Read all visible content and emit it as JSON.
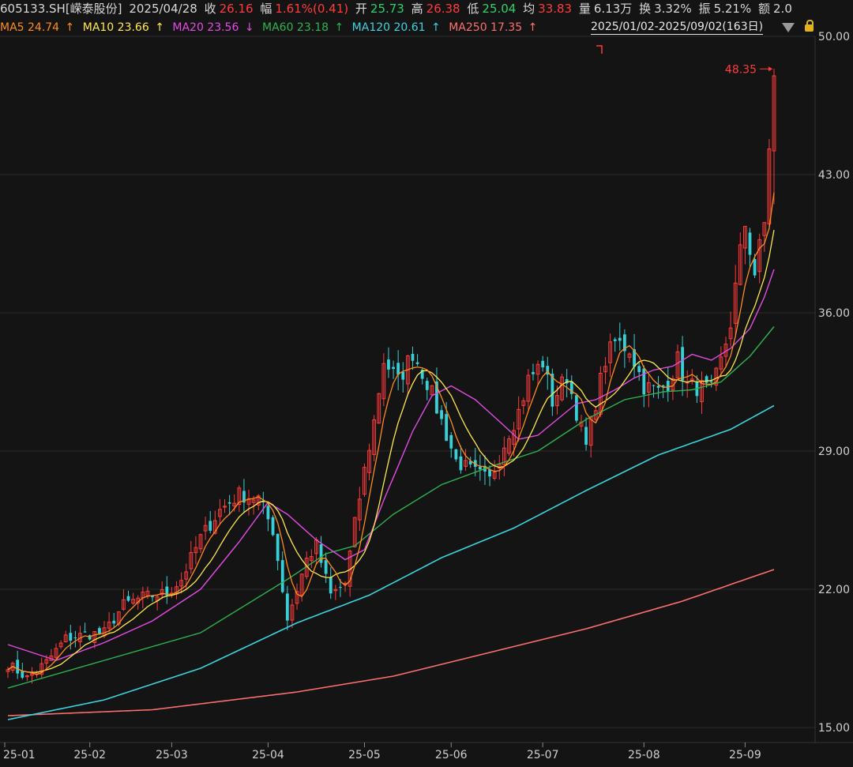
{
  "header": {
    "code": "605133.SH[嵘泰股份]",
    "date": "2025/04/28",
    "close_label": "收",
    "close": "26.16",
    "chg_label": "幅",
    "chg": "1.61%(0.41)",
    "open_label": "开",
    "open": "25.73",
    "high_label": "高",
    "high": "26.38",
    "low_label": "低",
    "low": "25.04",
    "avg_label": "均",
    "avg": "33.83",
    "vol_label": "量",
    "vol": "6.13万",
    "turn_label": "换",
    "turn": "3.32%",
    "amp_label": "振",
    "amp": "5.21%",
    "amt_label": "额",
    "amt": "2.0"
  },
  "ma_legend": [
    {
      "text": "MA5 24.74",
      "arrow": "↑",
      "color": "#ff8c1a"
    },
    {
      "text": "MA10 23.66",
      "arrow": "↑",
      "color": "#ffe84a"
    },
    {
      "text": "MA20 23.56",
      "arrow": "↓",
      "color": "#e34be3"
    },
    {
      "text": "MA60 23.18",
      "arrow": "↑",
      "color": "#2fb24f"
    },
    {
      "text": "MA120 20.61",
      "arrow": "↑",
      "color": "#39d4e0"
    },
    {
      "text": "MA250 17.35",
      "arrow": "↑",
      "color": "#ff6f6f"
    }
  ],
  "range_label": "2025/01/02-2025/09/02(163日)",
  "colors": {
    "up": "#ff3b3b",
    "down": "#37d0d8",
    "grid": "#2a2a2a",
    "background": "#141414"
  },
  "chart_data": {
    "type": "candlestick",
    "ylim": [
      15,
      50
    ],
    "yticks": [
      "50.00",
      "43.00",
      "36.00",
      "29.00",
      "22.00",
      "15.00"
    ],
    "ytick_values": [
      50,
      43,
      36,
      29,
      22,
      15
    ],
    "xticks": [
      "25-01",
      "25-02",
      "25-03",
      "25-04",
      "25-05",
      "25-06",
      "25-07",
      "25-08",
      "25-09"
    ],
    "xtick_index": [
      0,
      17,
      34,
      54,
      74,
      92,
      111,
      132,
      153
    ],
    "n_days": 156,
    "annotation": {
      "label": "48.35",
      "value": 48.35
    },
    "anchors": [
      [
        0,
        18.2
      ],
      [
        4,
        17.5
      ],
      [
        8,
        18.3
      ],
      [
        12,
        19.5
      ],
      [
        16,
        19.7
      ],
      [
        20,
        19.8
      ],
      [
        24,
        21.2
      ],
      [
        28,
        21.6
      ],
      [
        33,
        21.8
      ],
      [
        36,
        22.5
      ],
      [
        40,
        24.6
      ],
      [
        44,
        26.0
      ],
      [
        48,
        26.8
      ],
      [
        52,
        26.6
      ],
      [
        55,
        25.0
      ],
      [
        58,
        20.5
      ],
      [
        62,
        23.5
      ],
      [
        64,
        24.2
      ],
      [
        67,
        21.7
      ],
      [
        70,
        22.3
      ],
      [
        72,
        25.3
      ],
      [
        74,
        28.0
      ],
      [
        76,
        30.5
      ],
      [
        78,
        33.6
      ],
      [
        81,
        32.5
      ],
      [
        84,
        34.0
      ],
      [
        87,
        32.5
      ],
      [
        90,
        30.5
      ],
      [
        93,
        28.5
      ],
      [
        96,
        28.0
      ],
      [
        100,
        27.5
      ],
      [
        104,
        30.0
      ],
      [
        106,
        31.0
      ],
      [
        108,
        32.6
      ],
      [
        111,
        33.5
      ],
      [
        113,
        31.5
      ],
      [
        116,
        32.8
      ],
      [
        118,
        31.0
      ],
      [
        120,
        29.2
      ],
      [
        122,
        31.5
      ],
      [
        124,
        33.6
      ],
      [
        126,
        34.5
      ],
      [
        129,
        34.2
      ],
      [
        132,
        32.3
      ],
      [
        135,
        32.0
      ],
      [
        137,
        32.5
      ],
      [
        139,
        33.6
      ],
      [
        141,
        32.3
      ],
      [
        144,
        32.2
      ],
      [
        146,
        32.0
      ],
      [
        148,
        33.5
      ],
      [
        150,
        35.5
      ],
      [
        152,
        39.0
      ],
      [
        153,
        40.5
      ],
      [
        155,
        38.0
      ],
      [
        157,
        40.5
      ],
      [
        158,
        43.0
      ],
      [
        159,
        46.3
      ]
    ],
    "ma": {
      "ma20": [
        [
          0,
          19.2
        ],
        [
          10,
          18.4
        ],
        [
          20,
          19.3
        ],
        [
          30,
          20.4
        ],
        [
          40,
          22.0
        ],
        [
          48,
          24.4
        ],
        [
          54,
          26.4
        ],
        [
          58,
          25.8
        ],
        [
          64,
          24.5
        ],
        [
          70,
          23.5
        ],
        [
          74,
          24.0
        ],
        [
          78,
          26.5
        ],
        [
          84,
          30.0
        ],
        [
          88,
          31.8
        ],
        [
          92,
          32.3
        ],
        [
          97,
          31.6
        ],
        [
          102,
          30.5
        ],
        [
          106,
          29.6
        ],
        [
          110,
          29.8
        ],
        [
          114,
          30.6
        ],
        [
          118,
          31.4
        ],
        [
          122,
          31.6
        ],
        [
          126,
          32.1
        ],
        [
          130,
          32.7
        ],
        [
          134,
          33.1
        ],
        [
          138,
          33.3
        ],
        [
          142,
          33.9
        ],
        [
          146,
          33.6
        ],
        [
          150,
          34.2
        ],
        [
          154,
          35.2
        ],
        [
          157,
          36.8
        ],
        [
          159,
          38.2
        ]
      ],
      "ma60": [
        [
          0,
          17.0
        ],
        [
          20,
          18.4
        ],
        [
          40,
          19.8
        ],
        [
          58,
          22.5
        ],
        [
          66,
          23.8
        ],
        [
          72,
          24.2
        ],
        [
          80,
          25.8
        ],
        [
          90,
          27.3
        ],
        [
          100,
          28.2
        ],
        [
          110,
          29.0
        ],
        [
          120,
          30.6
        ],
        [
          128,
          31.6
        ],
        [
          136,
          32.0
        ],
        [
          142,
          32.1
        ],
        [
          148,
          32.5
        ],
        [
          154,
          33.8
        ],
        [
          159,
          35.3
        ]
      ],
      "ma120": [
        [
          0,
          15.4
        ],
        [
          20,
          16.4
        ],
        [
          40,
          18.0
        ],
        [
          60,
          20.3
        ],
        [
          75,
          21.7
        ],
        [
          90,
          23.6
        ],
        [
          105,
          25.1
        ],
        [
          120,
          27.0
        ],
        [
          135,
          28.8
        ],
        [
          150,
          30.1
        ],
        [
          159,
          31.3
        ]
      ],
      "ma250": [
        [
          0,
          15.6
        ],
        [
          30,
          15.9
        ],
        [
          60,
          16.8
        ],
        [
          80,
          17.6
        ],
        [
          100,
          18.8
        ],
        [
          120,
          20.0
        ],
        [
          140,
          21.4
        ],
        [
          159,
          23.0
        ]
      ]
    }
  }
}
